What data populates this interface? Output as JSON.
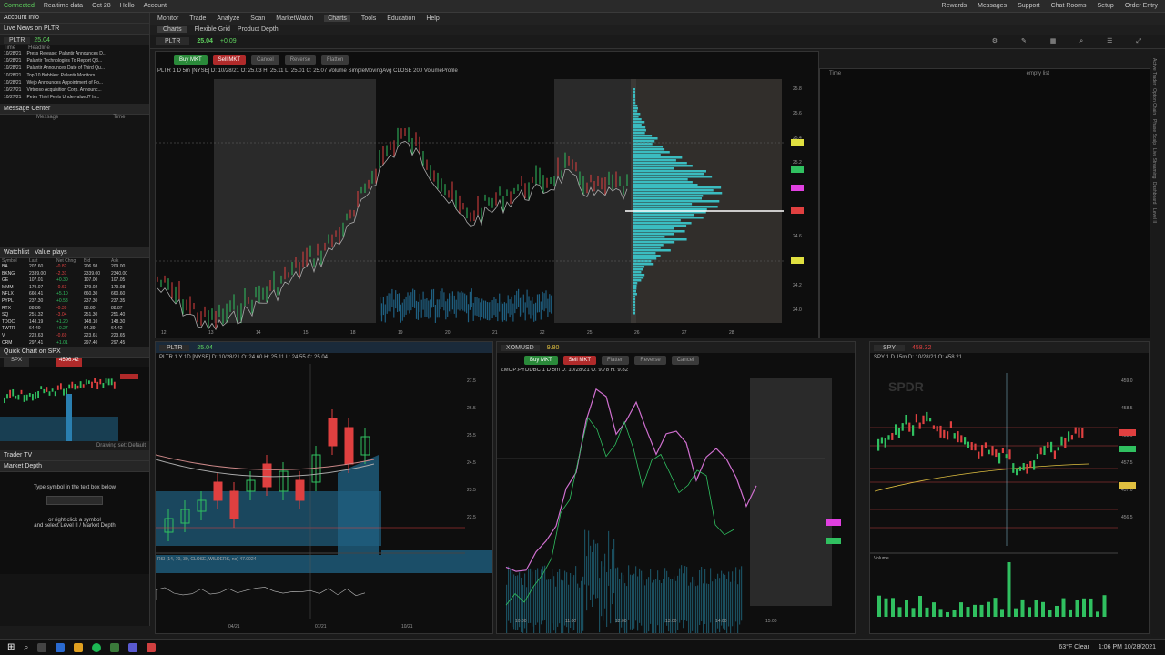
{
  "topbar": {
    "connected": "Connected",
    "status1": "Realtime data",
    "status2": "Oct 28",
    "status3": "Hello",
    "status4": "Account",
    "right": [
      "Rewards",
      "Messages",
      "Support",
      "Chat Rooms",
      "Setup",
      "Order Entry"
    ]
  },
  "left": {
    "account_info": "Account Info",
    "live_news": "Live News on PLTR",
    "news_symbol": "PLTR",
    "news_price": "25.04",
    "news_col_time": "Time",
    "news_col_headline": "Headline",
    "news": [
      {
        "t": "10/28/21",
        "h": "Press Release: Palantir Announces D..."
      },
      {
        "t": "10/28/21",
        "h": "Palantir Technologies To Report Q3..."
      },
      {
        "t": "10/28/21",
        "h": "Palantir Announces Date of Third Qu..."
      },
      {
        "t": "10/28/21",
        "h": "Top 10 Bubbles: Palantir Monitors..."
      },
      {
        "t": "10/28/21",
        "h": "Wejo Announces Appointment of Fo..."
      },
      {
        "t": "10/27/21",
        "h": "Virtuoso Acquisition Corp. Announc..."
      },
      {
        "t": "10/27/21",
        "h": "Peter Thiel Feels Undervalued? In..."
      }
    ],
    "message_center": "Message Center",
    "msg_col": "Message",
    "msg_time": "Time",
    "watchlist": "Watchlist",
    "watchlist_name": "Value plays",
    "wl_cols": [
      "Symbol",
      "Last",
      "Net Chng",
      "Bid",
      "Ask"
    ],
    "wl": [
      {
        "s": "BA",
        "l": "207.60",
        "c": "-0.82",
        "b": "206.98",
        "a": "209.00"
      },
      {
        "s": "BKNG",
        "l": "2339.00",
        "c": "-2.31",
        "b": "2339.00",
        "a": "2340.00"
      },
      {
        "s": "GE",
        "l": "107.01",
        "c": "+0.30",
        "b": "107.00",
        "a": "107.05"
      },
      {
        "s": "MMM",
        "l": "179.07",
        "c": "-0.63",
        "b": "179.02",
        "a": "179.08"
      },
      {
        "s": "NFLX",
        "l": "660.41",
        "c": "+5.10",
        "b": "660.30",
        "a": "660.60"
      },
      {
        "s": "PYPL",
        "l": "237.30",
        "c": "+0.58",
        "b": "237.30",
        "a": "237.35"
      },
      {
        "s": "RTX",
        "l": "88.86",
        "c": "-0.39",
        "b": "88.80",
        "a": "88.87"
      },
      {
        "s": "SQ",
        "l": "251.32",
        "c": "-3.04",
        "b": "251.30",
        "a": "251.40"
      },
      {
        "s": "TDOC",
        "l": "148.19",
        "c": "+1.20",
        "b": "148.10",
        "a": "148.30"
      },
      {
        "s": "TWTR",
        "l": "64.40",
        "c": "+0.27",
        "b": "64.39",
        "a": "64.42"
      },
      {
        "s": "V",
        "l": "223.63",
        "c": "-0.69",
        "b": "223.61",
        "a": "223.65"
      },
      {
        "s": "CRM",
        "l": "297.41",
        "c": "+1.01",
        "b": "297.40",
        "a": "297.45"
      }
    ],
    "quickchart": "Quick Chart on SPX",
    "qc_symbol": "SPX",
    "qc_price": "4596.42",
    "trader_tv": "Trader TV",
    "market_depth": "Market Depth",
    "md_line1": "Type symbol in the text box below",
    "md_line2": "or right click a symbol",
    "md_line3": "and select Level II / Market Depth",
    "drawing_set": "Drawing set: Default"
  },
  "menu": [
    "Monitor",
    "Trade",
    "Analyze",
    "Scan",
    "MarketWatch",
    "Charts",
    "Tools",
    "Education",
    "Help"
  ],
  "tabs": [
    "Charts",
    "Flexible Grid",
    "Product Depth"
  ],
  "main": {
    "symbol": "PLTR",
    "price": "25.04",
    "change": "+0.09",
    "header": "PLTR 1 D 5m [NYSE]  D: 10/28/21  O: 25.03  H: 25.11  L: 25.01  C: 25.07  Volume  SimpleMovingAvg CLOSE 200  VolumeProfile",
    "buy": "Buy MKT",
    "sell": "Sell MKT",
    "b3": "Cancel",
    "b4": "Reverse",
    "b5": "Flatten",
    "prices": [
      "25.8",
      "25.6",
      "25.4",
      "25.2",
      "25.0",
      "24.8",
      "24.6",
      "24.4",
      "24.2",
      "24.0"
    ],
    "dates": [
      "12",
      "13",
      "14",
      "15",
      "18",
      "19",
      "20",
      "21",
      "22",
      "25",
      "26",
      "27",
      "28"
    ]
  },
  "right_top": {
    "title": "Time",
    "sub": "empty list"
  },
  "c2": {
    "symbol": "PLTR",
    "price": "25.04",
    "header": "PLTR 1 Y 1D [NYSE]  D: 10/28/21  O: 24.60  H: 25.11  L: 24.55  C: 25.04",
    "buy": "",
    "prices": [
      "27.5",
      "26.5",
      "25.5",
      "24.5",
      "23.5",
      "22.5"
    ],
    "rsi": "RSI (14, 70, 30, CLOSE, WILDERS, no) 47.0024",
    "dates": [
      "04/21",
      "07/21",
      "10/21"
    ]
  },
  "c3": {
    "symbol": "XOMUSD",
    "price": "9.80",
    "header": "ZMOP:PYDDBC 1 D 5m  D: 10/28/21  O: 9.78  H: 9.82",
    "buy": "Buy MKT",
    "sell": "Sell MKT",
    "b3": "Flatten",
    "b4": "Reverse",
    "b5": "Cancel",
    "dates": [
      "10:00",
      "11:00",
      "12:00",
      "13:00",
      "14:00",
      "15:00"
    ]
  },
  "c4": {
    "symbol": "SPY",
    "price": "458.32",
    "header": "SPY 1 D 15m  D: 10/28/21  O: 458.21",
    "watermark": "SPDR",
    "vol": "Volume",
    "prices": [
      "459.0",
      "458.5",
      "458.0",
      "457.5",
      "457.0",
      "456.5"
    ]
  },
  "rightbar": [
    "Active Trader",
    "Option Chain",
    "Phase Scalp",
    "Live Streaming",
    "Dashboard",
    "Level II"
  ],
  "taskbar": {
    "weather": "63°F Clear",
    "time": "1:06 PM",
    "date": "10/28/2021"
  },
  "colors": {
    "up": "#30c060",
    "down": "#e04040",
    "profile": "#3bbcc0"
  }
}
